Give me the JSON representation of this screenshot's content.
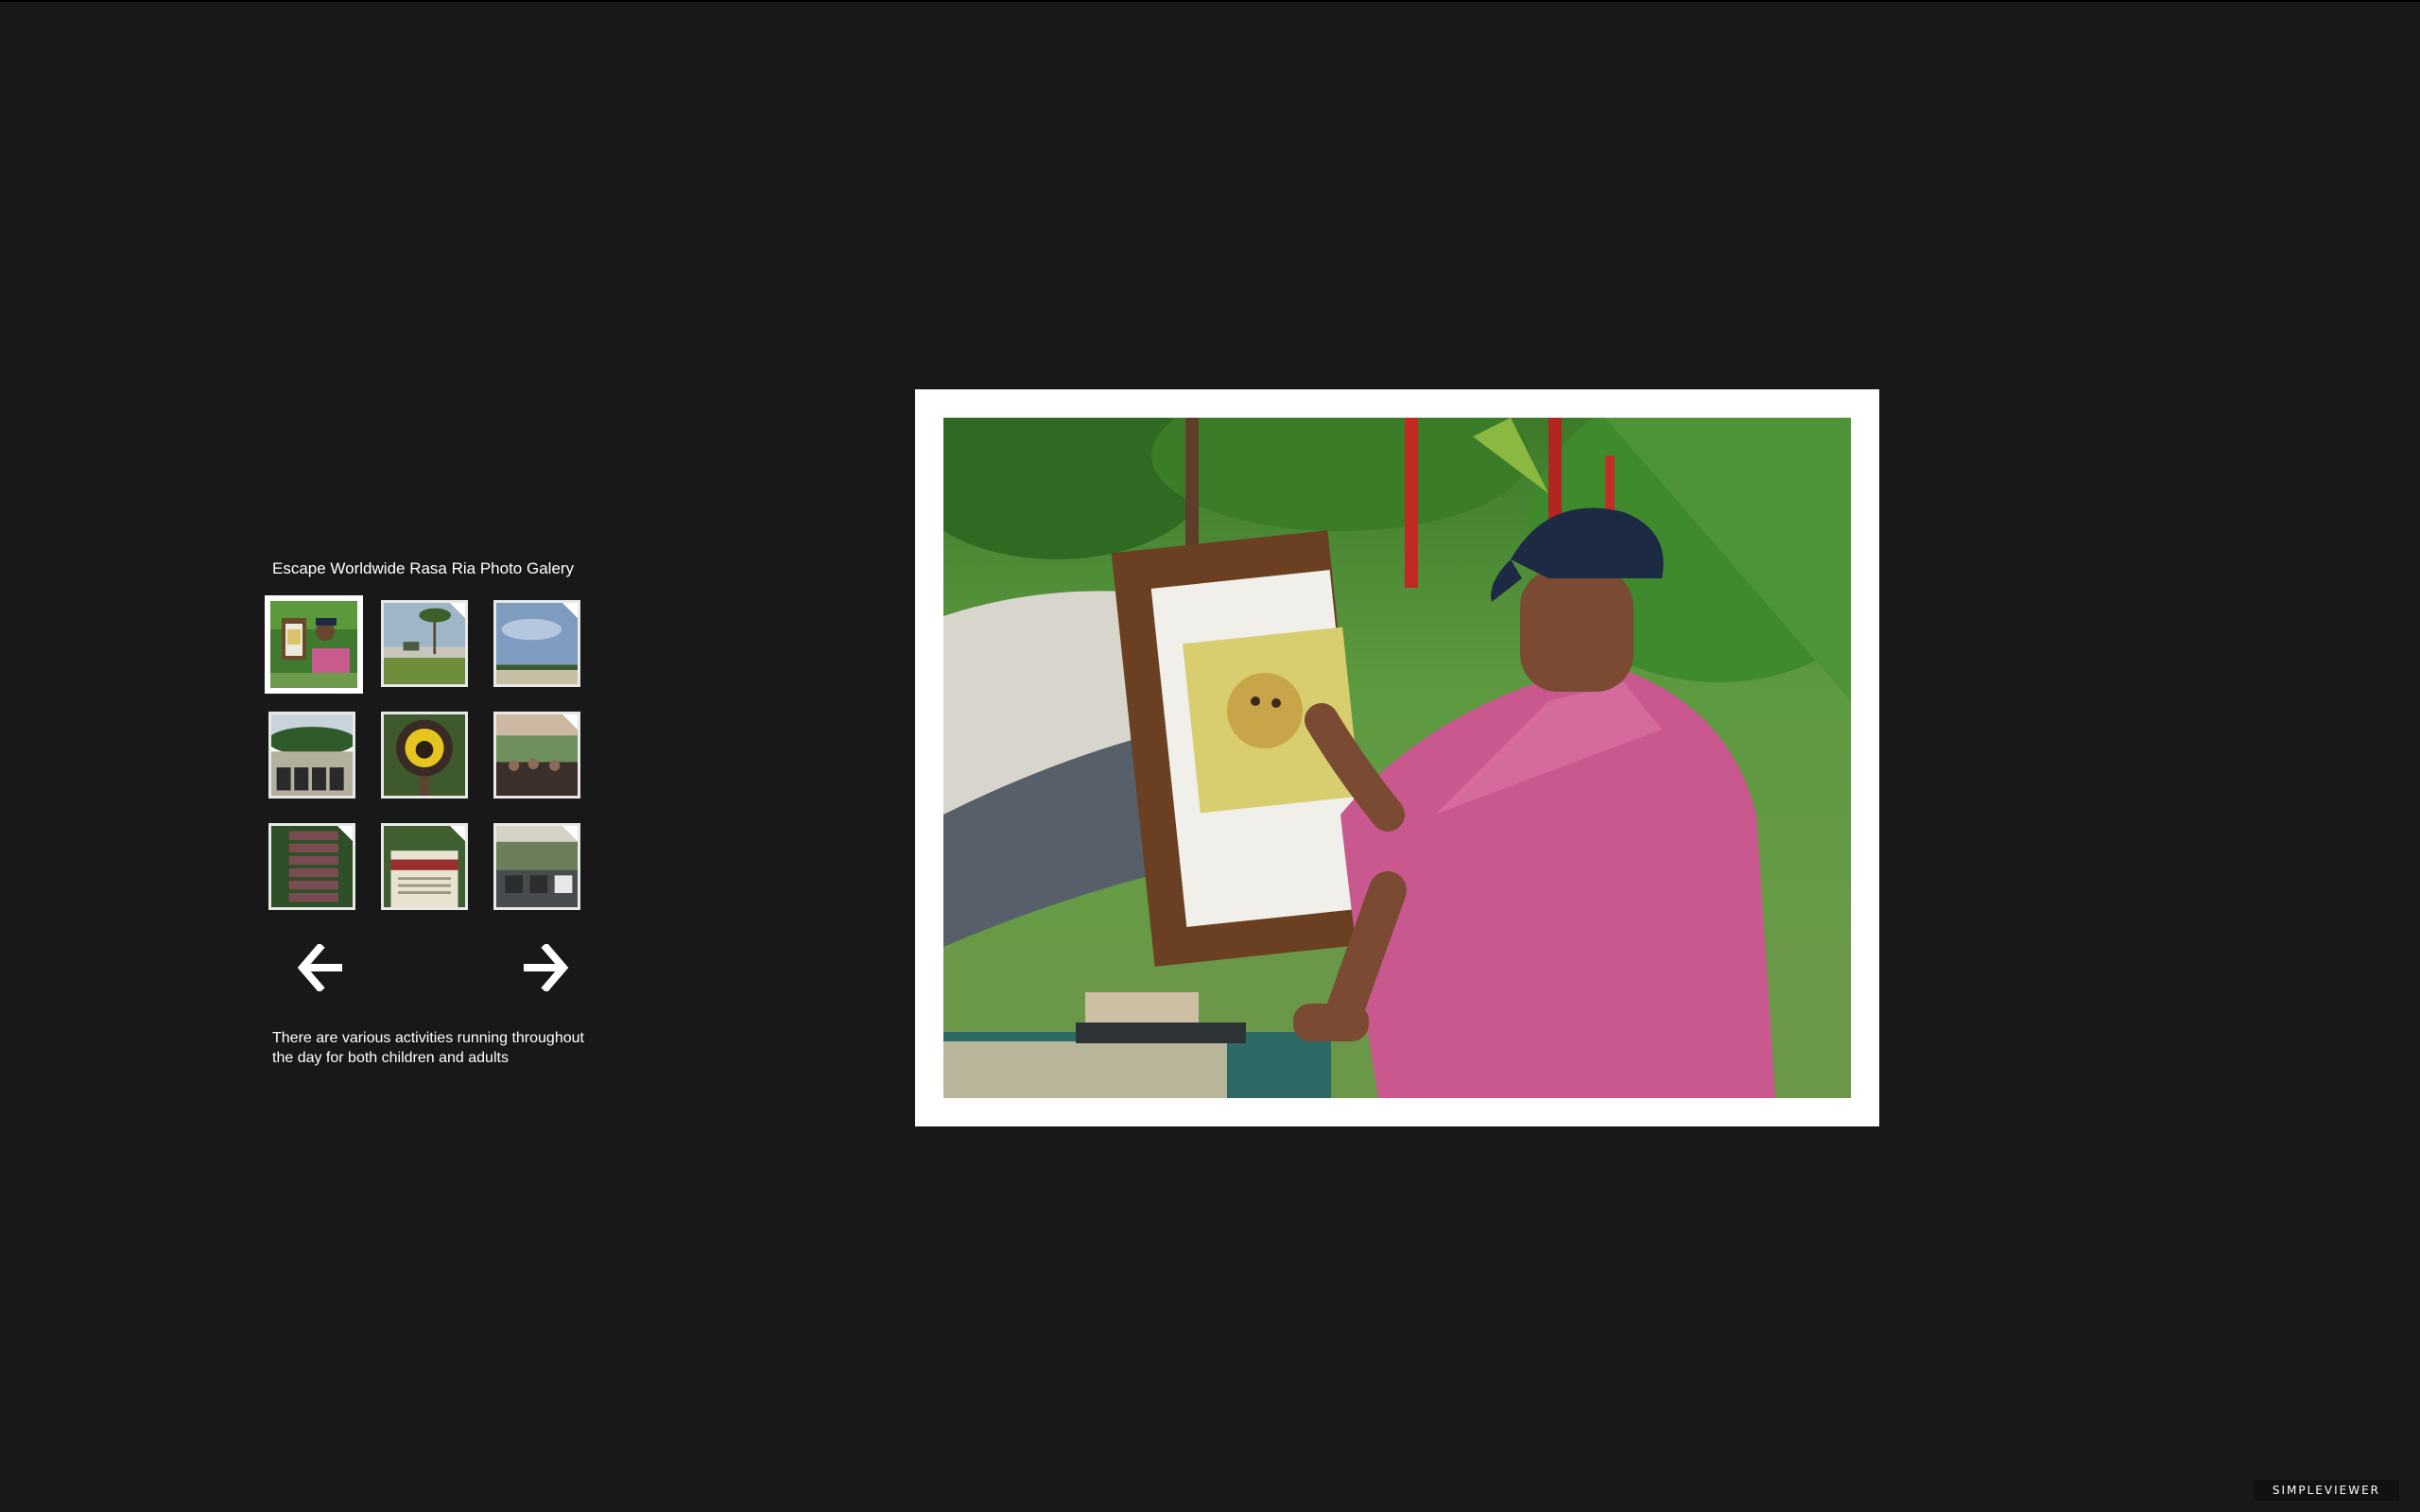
{
  "gallery": {
    "title": "Escape Worldwide Rasa Ria Photo Galery",
    "caption": "There are various activities running throughout the day for both children and adults",
    "selected_index": 0,
    "thumbnails": [
      {
        "subject": "artist painting at easel"
      },
      {
        "subject": "beach with palm tree"
      },
      {
        "subject": "sky over sea"
      },
      {
        "subject": "beach loungers"
      },
      {
        "subject": "orangutan sign"
      },
      {
        "subject": "pavilion with guests"
      },
      {
        "subject": "activity signpost"
      },
      {
        "subject": "play sign"
      },
      {
        "subject": "outdoor dining area"
      }
    ],
    "prev_icon": "arrow-left-icon",
    "next_icon": "arrow-right-icon"
  },
  "branding": {
    "label": "SIMPLEVIEWER"
  },
  "colors": {
    "background": "#181818",
    "frame": "#ffffff",
    "text": "#ffffff"
  }
}
